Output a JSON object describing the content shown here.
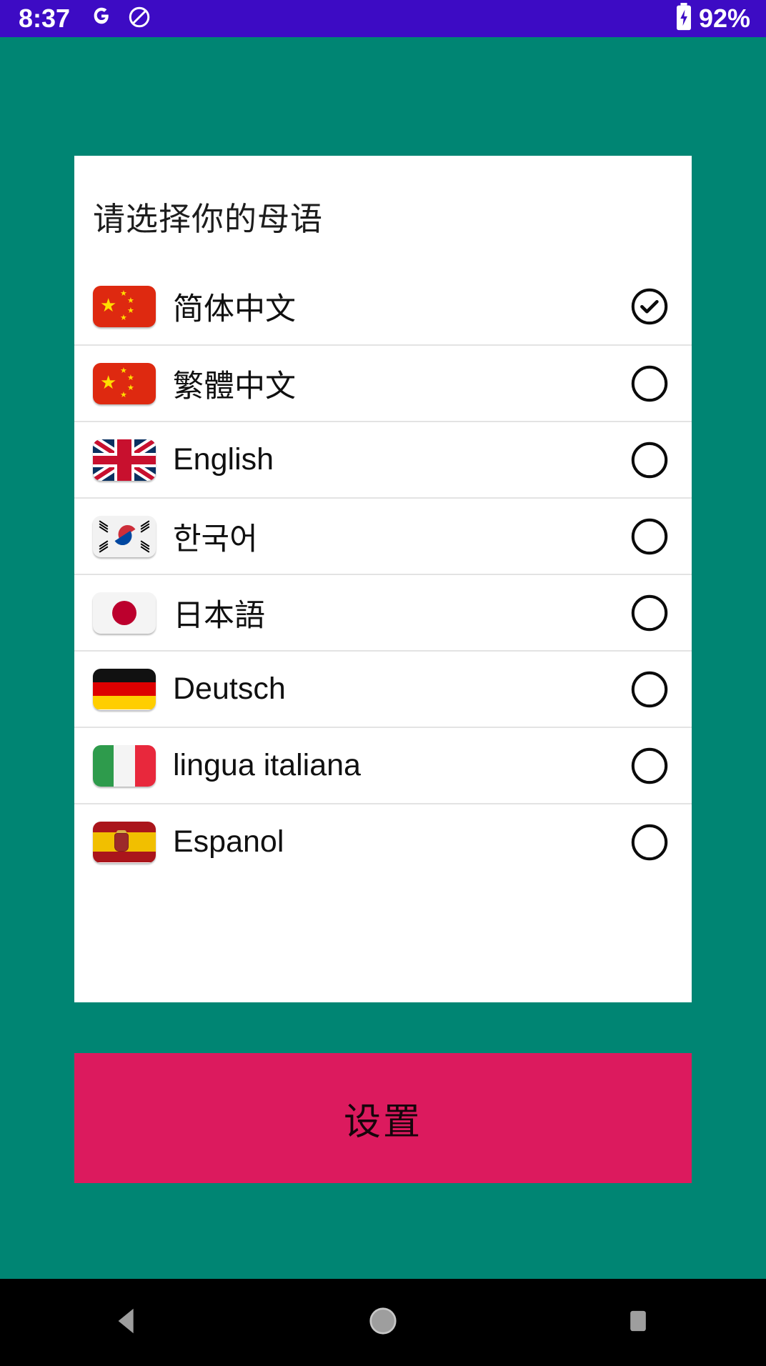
{
  "status_bar": {
    "time": "8:37",
    "battery_percent": "92%",
    "icons": [
      "google-g-icon",
      "do-not-disturb-icon",
      "battery-charging-icon"
    ],
    "background_color": "#3D0BC4"
  },
  "screen": {
    "background_color": "#008573"
  },
  "card": {
    "title": "请选择你的母语",
    "languages": [
      {
        "label": "简体中文",
        "flag": "flag-china",
        "selected": true
      },
      {
        "label": "繁體中文",
        "flag": "flag-china",
        "selected": false
      },
      {
        "label": "English",
        "flag": "flag-united-kingdom",
        "selected": false
      },
      {
        "label": "한국어",
        "flag": "flag-south-korea",
        "selected": false
      },
      {
        "label": "日本語",
        "flag": "flag-japan",
        "selected": false
      },
      {
        "label": "Deutsch",
        "flag": "flag-germany",
        "selected": false
      },
      {
        "label": "lingua italiana",
        "flag": "flag-italy",
        "selected": false
      },
      {
        "label": "Espanol",
        "flag": "flag-spain",
        "selected": false
      }
    ]
  },
  "primary_button": {
    "label": "设置",
    "background_color": "#DC1A5E",
    "text_color": "#16050b"
  },
  "nav_bar": {
    "background_color": "#000000",
    "buttons": [
      "back-icon",
      "home-icon",
      "recents-icon"
    ]
  }
}
